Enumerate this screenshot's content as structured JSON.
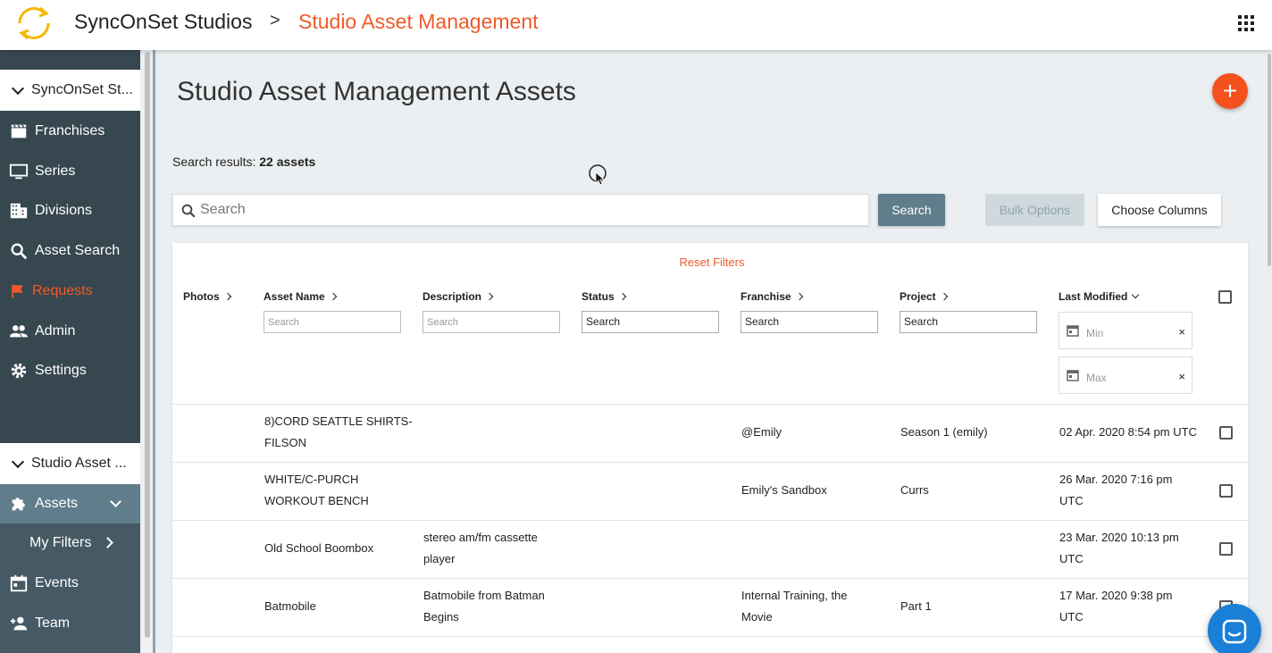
{
  "header": {
    "org_name": "SyncOnSet Studios",
    "breadcrumb_separator": ">",
    "current_page": "Studio Asset Management",
    "accent_color": "#f05a28"
  },
  "sidebar": {
    "section_primary": "SyncOnSet St...",
    "items": [
      {
        "label": "Franchises",
        "icon": "clapperboard-icon"
      },
      {
        "label": "Series",
        "icon": "monitor-icon"
      },
      {
        "label": "Divisions",
        "icon": "building-icon"
      },
      {
        "label": "Asset Search",
        "icon": "search-icon"
      },
      {
        "label": "Requests",
        "icon": "flag-icon"
      },
      {
        "label": "Admin",
        "icon": "people-icon"
      },
      {
        "label": "Settings",
        "icon": "gear-icon"
      }
    ],
    "section_secondary": "Studio Asset ...",
    "sub_items": [
      {
        "label": "Assets",
        "icon": "puzzle-icon"
      },
      {
        "label": "My Filters"
      },
      {
        "label": "Events",
        "icon": "calendar-icon"
      },
      {
        "label": "Team",
        "icon": "add-person-icon"
      }
    ]
  },
  "main": {
    "title": "Studio Asset Management Assets",
    "fab_label": "+",
    "results_prefix": "Search results:",
    "results_count": "22 assets",
    "search_placeholder": "Search",
    "search_button": "Search",
    "bulk_button": "Bulk Options",
    "columns_button": "Choose Columns"
  },
  "table": {
    "reset_filters": "Reset Filters",
    "columns": [
      "Photos",
      "Asset Name",
      "Description",
      "Status",
      "Franchise",
      "Project",
      "Last Modified"
    ],
    "filter_placeholder": "Search",
    "date_min": "Min",
    "date_max": "Max",
    "date_clear": "×",
    "rows": [
      {
        "name": [
          "8)CORD SEATTLE SHIRTS-",
          "FILSON"
        ],
        "description": [
          "",
          ""
        ],
        "status": "",
        "franchise": [
          "@Emily",
          ""
        ],
        "project": "Season 1 (emily)",
        "modified": [
          "02 Apr. 2020 8:54 pm UTC",
          ""
        ]
      },
      {
        "name": [
          "WHITE/C-PURCH",
          "WORKOUT BENCH"
        ],
        "description": [
          "",
          ""
        ],
        "status": "",
        "franchise": [
          "Emily's Sandbox",
          ""
        ],
        "project": "Currs",
        "modified": [
          "26 Mar. 2020 7:16 pm",
          "UTC"
        ]
      },
      {
        "name": [
          "Old School Boombox",
          ""
        ],
        "description": [
          "stereo am/fm cassette",
          "player"
        ],
        "status": "",
        "franchise": [
          "",
          ""
        ],
        "project": "",
        "modified": [
          "23 Mar. 2020 10:13 pm",
          "UTC"
        ]
      },
      {
        "name": [
          "Batmobile",
          ""
        ],
        "description": [
          "Batmobile from Batman",
          "Begins"
        ],
        "status": "",
        "franchise": [
          "Internal Training, the",
          "Movie"
        ],
        "project": "Part 1",
        "modified": [
          "17 Mar. 2020 9:38 pm",
          "UTC"
        ]
      }
    ]
  }
}
